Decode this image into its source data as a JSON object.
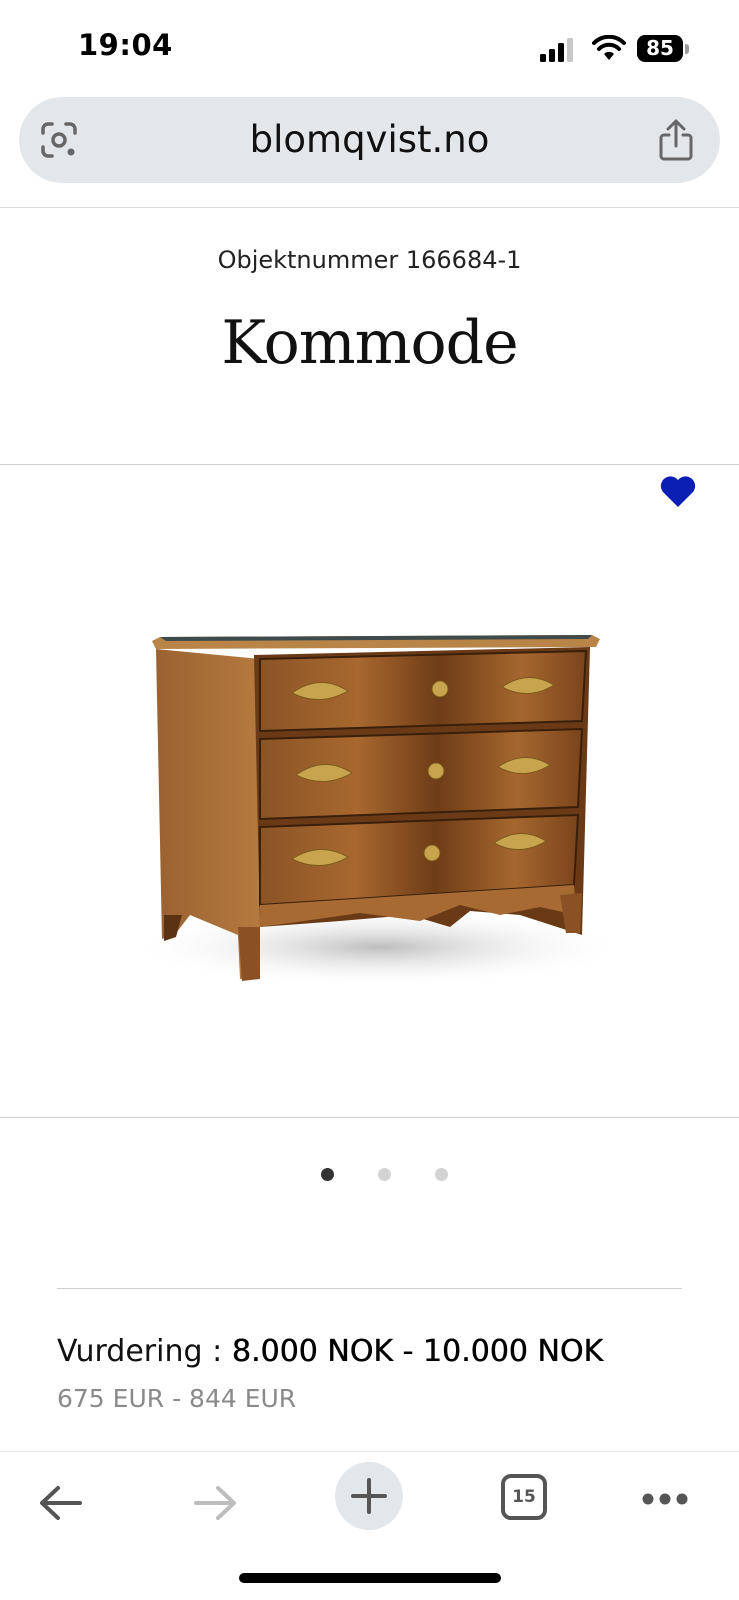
{
  "status_bar": {
    "time": "19:04",
    "battery": "85"
  },
  "browser": {
    "url": "blomqvist.no",
    "tab_count": "15"
  },
  "product": {
    "object_number": "Objektnummer 166684-1",
    "title": "Kommode",
    "image_count": 3,
    "active_image": 1,
    "favorited": true
  },
  "pricing": {
    "label": "Vurdering :",
    "value": "8.000 NOK - 10.000 NOK",
    "eur": "675 EUR - 844 EUR"
  },
  "colors": {
    "heart": "#0b1fb4",
    "accent_gray": "#e4e7ea"
  },
  "icons": [
    "lens-icon",
    "share-icon",
    "heart-icon",
    "back-arrow-icon",
    "forward-arrow-icon",
    "plus-icon",
    "tabs-icon",
    "more-icon"
  ]
}
